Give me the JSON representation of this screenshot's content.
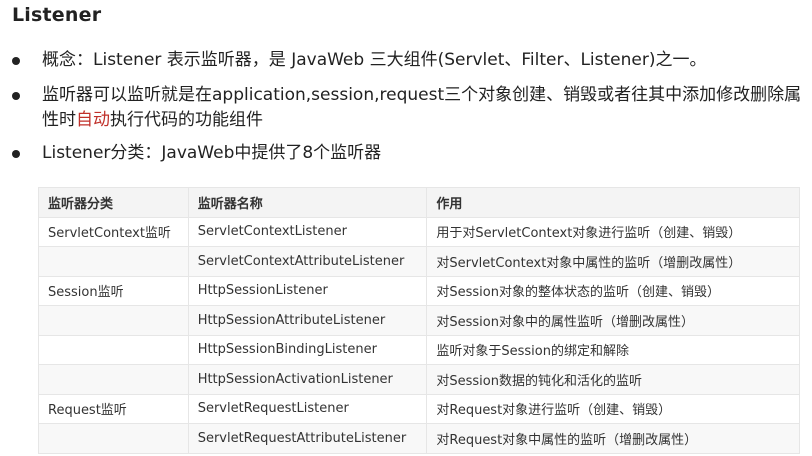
{
  "title": "Listener",
  "bullets": [
    {
      "text": "概念：Listener 表示监听器，是 JavaWeb 三大组件(Servlet、Filter、Listener)之一。"
    },
    {
      "pre": "监听器可以监听就是在application,session,request三个对象创建、销毁或者往其中添加修改删除属性时",
      "highlight": "自动",
      "post": "执行代码的功能组件"
    },
    {
      "text": "Listener分类：JavaWeb中提供了8个监听器"
    }
  ],
  "table": {
    "headers": [
      "监听器分类",
      "监听器名称",
      "作用"
    ],
    "rows": [
      [
        "ServletContext监听",
        "ServletContextListener",
        "用于对ServletContext对象进行监听（创建、销毁）"
      ],
      [
        "",
        "ServletContextAttributeListener",
        "对ServletContext对象中属性的监听（增删改属性）"
      ],
      [
        "Session监听",
        "HttpSessionListener",
        "对Session对象的整体状态的监听（创建、销毁）"
      ],
      [
        "",
        "HttpSessionAttributeListener",
        "对Session对象中的属性监听（增删改属性）"
      ],
      [
        "",
        "HttpSessionBindingListener",
        "监听对象于Session的绑定和解除"
      ],
      [
        "",
        "HttpSessionActivationListener",
        "对Session数据的钝化和活化的监听"
      ],
      [
        "Request监听",
        "ServletRequestListener",
        "对Request对象进行监听（创建、销毁）"
      ],
      [
        "",
        "ServletRequestAttributeListener",
        "对Request对象中属性的监听（增删改属性）"
      ]
    ]
  },
  "colors": {
    "highlight": "#c0302a",
    "header_bg": "#f4f4f4",
    "border": "#e6e6e6"
  }
}
